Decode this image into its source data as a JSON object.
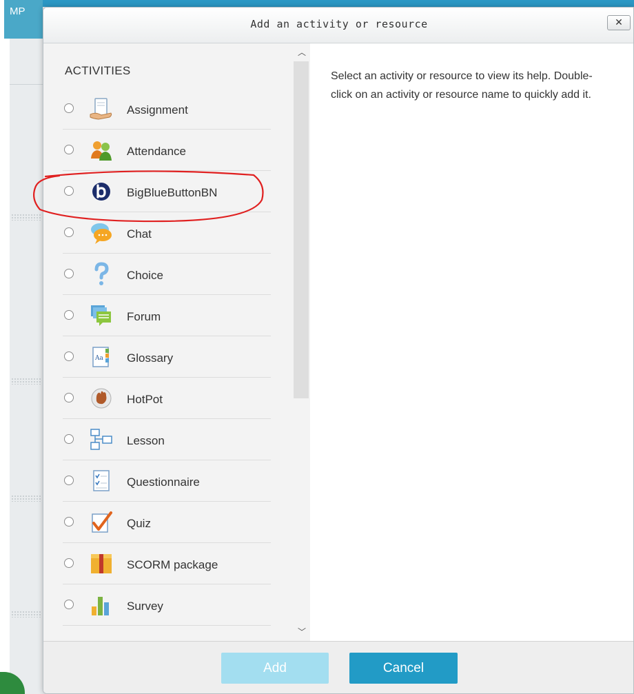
{
  "background": {
    "tab_label": "MP"
  },
  "dialog": {
    "title": "Add an activity or resource",
    "close_label": "✕",
    "section_title": "ACTIVITIES",
    "help_text": "Select an activity or resource to view its help. Double-click on an activity or resource name to quickly add it.",
    "activities": [
      {
        "label": "Assignment",
        "icon": "assignment-icon"
      },
      {
        "label": "Attendance",
        "icon": "attendance-icon"
      },
      {
        "label": "BigBlueButtonBN",
        "icon": "bigbluebutton-icon"
      },
      {
        "label": "Chat",
        "icon": "chat-icon"
      },
      {
        "label": "Choice",
        "icon": "choice-icon"
      },
      {
        "label": "Forum",
        "icon": "forum-icon"
      },
      {
        "label": "Glossary",
        "icon": "glossary-icon"
      },
      {
        "label": "HotPot",
        "icon": "hotpot-icon"
      },
      {
        "label": "Lesson",
        "icon": "lesson-icon"
      },
      {
        "label": "Questionnaire",
        "icon": "questionnaire-icon"
      },
      {
        "label": "Quiz",
        "icon": "quiz-icon"
      },
      {
        "label": "SCORM package",
        "icon": "scorm-icon"
      },
      {
        "label": "Survey",
        "icon": "survey-icon"
      }
    ],
    "add_label": "Add",
    "cancel_label": "Cancel",
    "colors": {
      "add_button": "#a3def0",
      "cancel_button": "#229bc6",
      "annotation": "#e02020"
    }
  }
}
